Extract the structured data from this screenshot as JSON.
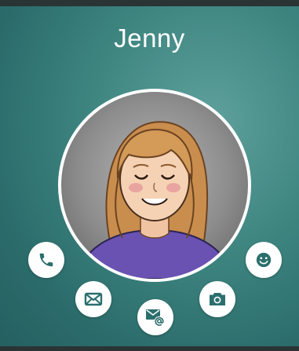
{
  "contact": {
    "name": "Jenny"
  },
  "actions": [
    {
      "id": "call",
      "icon": "phone-icon"
    },
    {
      "id": "message",
      "icon": "envelope-icon"
    },
    {
      "id": "email",
      "icon": "email-at-icon"
    },
    {
      "id": "photo",
      "icon": "camera-icon"
    },
    {
      "id": "emoji",
      "icon": "smiley-icon"
    }
  ],
  "colors": {
    "background": "#3e8580",
    "icon": "#2b6f6d",
    "button": "#ffffff"
  }
}
